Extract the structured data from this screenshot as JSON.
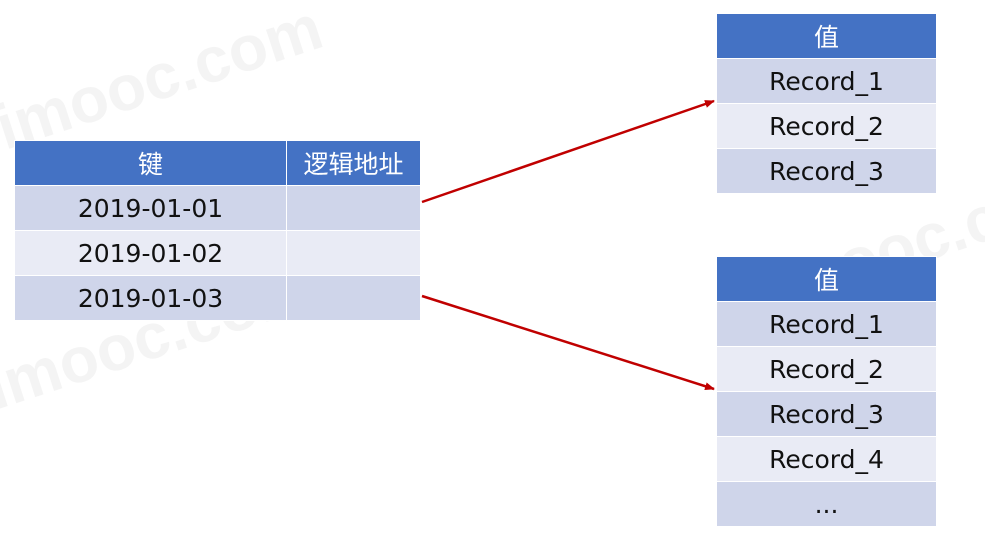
{
  "key_table": {
    "headers": [
      "键",
      "逻辑地址"
    ],
    "rows": [
      {
        "key": "2019-01-01",
        "address": ""
      },
      {
        "key": "2019-01-02",
        "address": ""
      },
      {
        "key": "2019-01-03",
        "address": ""
      }
    ]
  },
  "value_table_1": {
    "header": "值",
    "rows": [
      "Record_1",
      "Record_2",
      "Record_3"
    ]
  },
  "value_table_2": {
    "header": "值",
    "rows": [
      "Record_1",
      "Record_2",
      "Record_3",
      "Record_4",
      "..."
    ]
  },
  "watermark": {
    "text": "imooc.com"
  },
  "colors": {
    "header": "#4472c4",
    "row_dark": "#cfd5ea",
    "row_light": "#e9ebf5",
    "arrow": "#c00000"
  }
}
